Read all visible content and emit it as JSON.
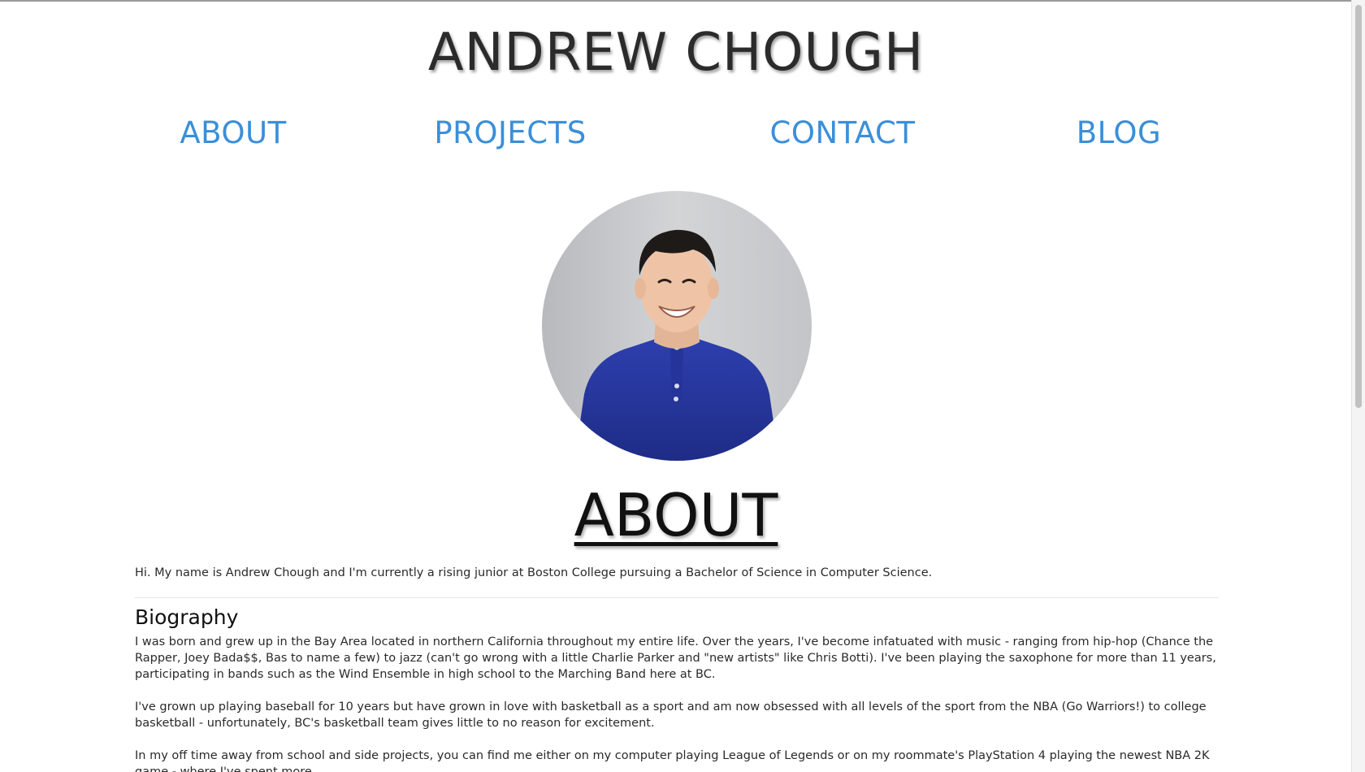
{
  "header": {
    "title": "ANDREW CHOUGH"
  },
  "nav": {
    "items": [
      {
        "label": "ABOUT"
      },
      {
        "label": "PROJECTS"
      },
      {
        "label": "CONTACT"
      },
      {
        "label": "BLOG"
      }
    ]
  },
  "about": {
    "heading": "ABOUT",
    "intro": "Hi. My name is Andrew Chough and I'm currently a rising junior at Boston College pursuing a Bachelor of Science in Computer Science.",
    "biography_heading": "Biography",
    "biography_paragraphs": [
      "I was born and grew up in the Bay Area located in northern California throughout my entire life. Over the years, I've become infatuated with music - ranging from hip-hop (Chance the Rapper, Joey Bada$$, Bas to name a few) to jazz (can't go wrong with a little Charlie Parker and \"new artists\" like Chris Botti). I've been playing the saxophone for more than 11 years, participating in bands such as the Wind Ensemble in high school to the Marching Band here at BC.",
      "I've grown up playing baseball for 10 years but have grown in love with basketball as a sport and am now obsessed with all levels of the sport from the NBA (Go Warriors!) to college basketball - unfortunately, BC's basketball team gives little to no reason for excitement.",
      "In my off time away from school and side projects, you can find me either on my computer playing League of Legends or on my roommate's PlayStation 4 playing the newest NBA 2K game - where I've spent more"
    ]
  },
  "colors": {
    "nav_link": "#3a8fd9",
    "title": "#2b2b2b",
    "shirt": "#2a3aa0",
    "wall": "#c9cacd"
  }
}
